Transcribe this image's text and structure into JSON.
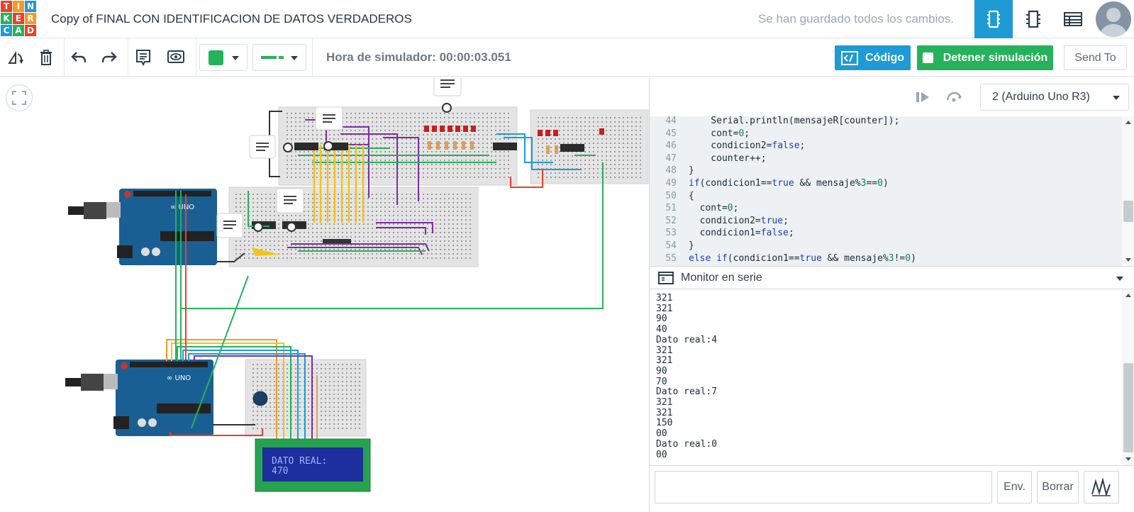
{
  "app": {
    "logo_letters": [
      "T",
      "I",
      "N",
      "K",
      "E",
      "R",
      "C",
      "A",
      "D"
    ],
    "logo_colors": [
      "#e8412b",
      "#f59a23",
      "#1e9ad6",
      "#26b15b",
      "#e8412b",
      "#f59a23",
      "#1e9ad6",
      "#26b15b",
      "#e8412b"
    ],
    "document_title": "Copy of FINAL CON IDENTIFICACION DE DATOS VERDADEROS",
    "save_status": "Se han guardado todos los cambios.",
    "accent_color": "#1e9ad6",
    "success_color": "#26b15b"
  },
  "header": {
    "views": [
      {
        "name": "circuit-view-icon",
        "active": true
      },
      {
        "name": "schematic-view-icon",
        "active": false
      },
      {
        "name": "component-list-icon",
        "active": false
      }
    ]
  },
  "toolbar": {
    "sim_time_label": "Hora de simulador: 00:00:03.051",
    "code_label": "Código",
    "stop_label": "Detener simulación",
    "send_to_label": "Send To",
    "fill_color": "#26b15b",
    "wire_color": "#26b15b"
  },
  "code_panel": {
    "board_selected": "2 (Arduino Uno R3)",
    "lines": [
      {
        "n": "44",
        "html": "    Serial.println(mensajeR[counter]);"
      },
      {
        "n": "45",
        "html": "    cont=<span class=\"num\">0</span>;"
      },
      {
        "n": "46",
        "html": "    condicion2=<span class=\"kw\">false</span>;"
      },
      {
        "n": "47",
        "html": "    counter++;"
      },
      {
        "n": "48",
        "html": "}"
      },
      {
        "n": "49",
        "html": "<span class=\"kw\">if</span>(condicion1==<span class=\"kw\">true</span> &amp;&amp; mensaje%<span class=\"num\">3</span>==<span class=\"num\">0</span>)"
      },
      {
        "n": "50",
        "html": "{"
      },
      {
        "n": "51",
        "html": "  cont=<span class=\"num\">0</span>;"
      },
      {
        "n": "52",
        "html": "  condicion2=<span class=\"kw\">true</span>;"
      },
      {
        "n": "53",
        "html": "  condicion1=<span class=\"kw\">false</span>;"
      },
      {
        "n": "54",
        "html": "}"
      },
      {
        "n": "55",
        "html": "<span class=\"kw\">else</span> <span class=\"kw\">if</span>(condicion1==<span class=\"kw\">true</span> &amp;&amp; mensaje%<span class=\"num\">3</span>!=<span class=\"num\">0</span>)"
      }
    ]
  },
  "serial_monitor": {
    "title": "Monitor en serie",
    "lines": [
      "321",
      "321",
      "90",
      "40",
      "Dato real:4",
      "321",
      "321",
      "90",
      "70",
      "Dato real:7",
      "321",
      "321",
      "150",
      "00",
      "Dato real:0",
      "00"
    ],
    "input_placeholder": "",
    "send_label": "Env.",
    "clear_label": "Borrar"
  },
  "lcd": {
    "line1": "DATO REAL:",
    "line2": "470"
  }
}
